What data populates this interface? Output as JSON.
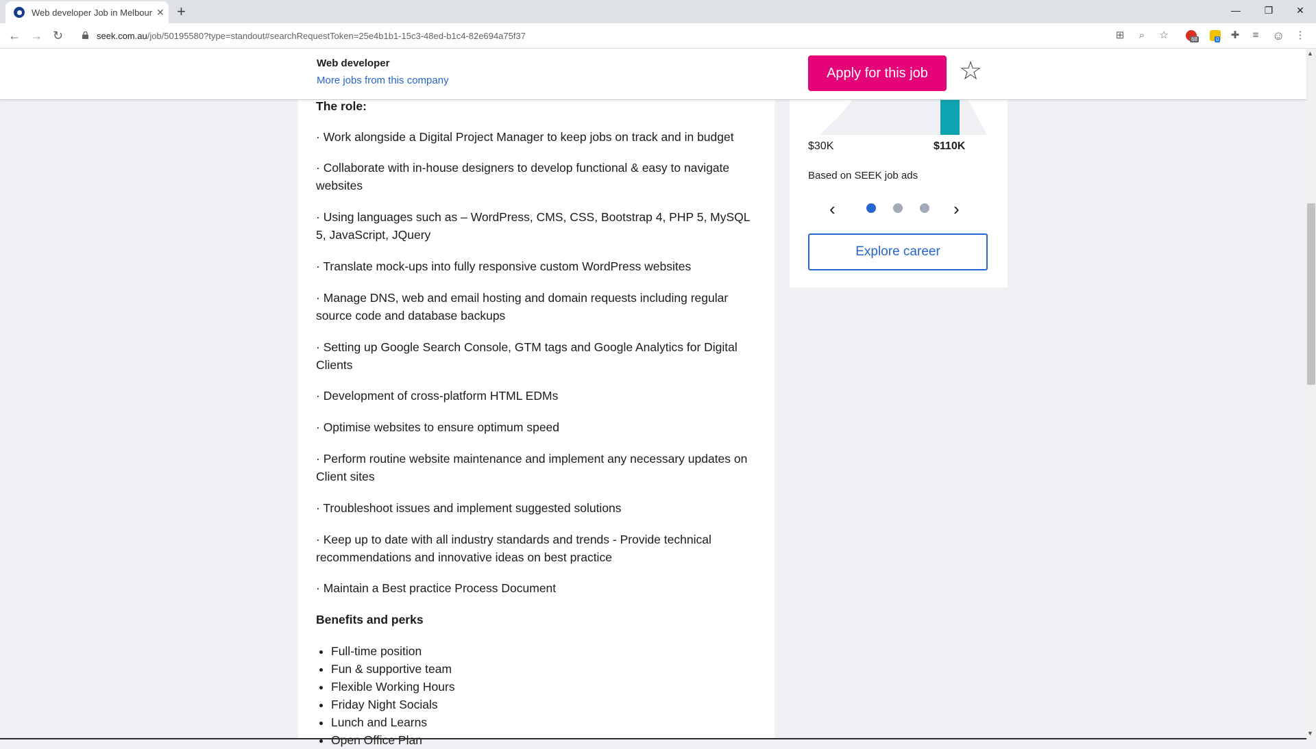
{
  "browser": {
    "tab_title": "Web developer Job in Melbourne",
    "url_host": "seek.com.au",
    "url_path": "/job/50195580?type=standout#searchRequestToken=25e4b1b1-15c3-48ed-b1c4-82e694a75f37",
    "ext_badge_1": "68",
    "ext_badge_2": "0"
  },
  "sticky": {
    "job_title": "Web developer",
    "more_jobs_link": "More jobs from this company",
    "apply_label": "Apply for this job"
  },
  "description": {
    "role_heading": "The role:",
    "bullets": [
      "· Work alongside a Digital Project Manager to keep jobs on track and in budget",
      "· Collaborate with in-house designers to develop functional & easy to navigate websites",
      "· Using languages such as – WordPress, CMS, CSS, Bootstrap 4, PHP 5, MySQL 5, JavaScript, JQuery",
      "· Translate mock-ups into fully responsive custom WordPress websites",
      "· Manage DNS, web and email hosting and domain requests including regular source code and database backups",
      "· Setting up Google Search Console, GTM tags and Google Analytics for Digital Clients",
      "· Development of cross-platform HTML EDMs",
      "· Optimise websites to ensure optimum speed",
      "· Perform routine website maintenance and implement any necessary updates on Client sites",
      "· Troubleshoot issues and implement suggested solutions",
      "· Keep up to date with all industry standards and trends - Provide technical recommendations and innovative ideas on best practice",
      "· Maintain a Best practice Process Document"
    ],
    "perks_heading": "Benefits and perks",
    "perks": [
      "Full-time position",
      "Fun & supportive team",
      "Flexible Working Hours",
      "Friday Night Socials",
      "Lunch and Learns",
      "Open Office Plan"
    ]
  },
  "salary_panel": {
    "low": "$30K",
    "high": "$110K",
    "based_on": "Based on SEEK job ads",
    "explore_label": "Explore career",
    "accent_color": "#0fa4af"
  },
  "colors": {
    "apply": "#e60278",
    "link": "#2765cf"
  }
}
